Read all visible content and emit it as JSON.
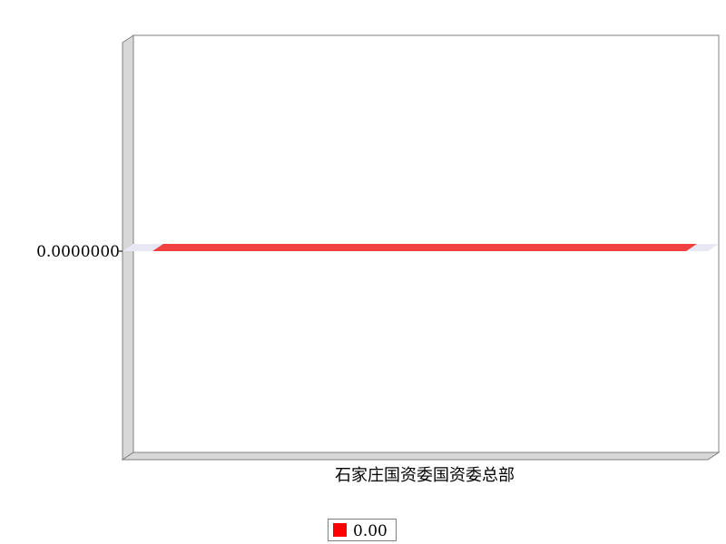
{
  "chart_data": {
    "type": "bar",
    "orientation": "horizontal",
    "three_d": true,
    "title": "",
    "xlabel": "",
    "ylabel": "",
    "categories": [
      "石家庄国资委国资委总部"
    ],
    "series": [
      {
        "name": "0.00",
        "values": [
          0
        ],
        "color": "#ff0000",
        "bar_color": "#f04040"
      }
    ],
    "value_axis": {
      "tick_labels": [
        "0.0000000"
      ],
      "ticks": [
        0
      ]
    },
    "grid": false,
    "legend": {
      "position": "bottom-center",
      "entries": [
        "0.00"
      ]
    },
    "colors": {
      "wall": "#ffffff",
      "wall_border": "#808080",
      "side_wall": "#d8d8d8",
      "floor": "#d8d8d8",
      "zero_plane": "#e8e8f4"
    }
  }
}
